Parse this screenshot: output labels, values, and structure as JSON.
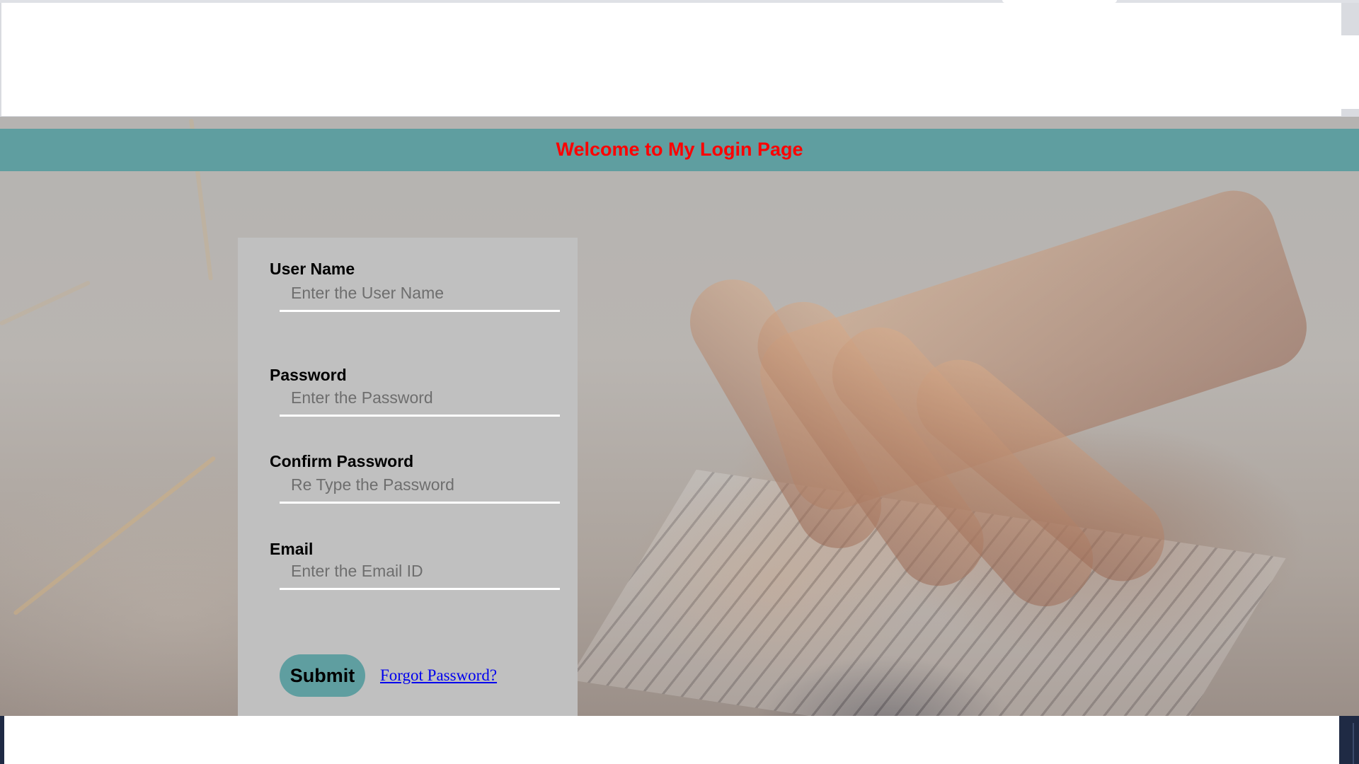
{
  "banner": {
    "title": "Welcome to My Login Page"
  },
  "form": {
    "username": {
      "label": "User Name",
      "placeholder": "Enter the User Name",
      "value": ""
    },
    "password": {
      "label": "Password",
      "placeholder": "Enter the Password",
      "value": ""
    },
    "confirm_password": {
      "label": "Confirm Password",
      "placeholder": "Re Type the Password",
      "value": ""
    },
    "email": {
      "label": "Email",
      "placeholder": "Enter the Email ID",
      "value": ""
    },
    "submit_label": "Submit",
    "forgot_label": "Forgot Password?"
  },
  "colors": {
    "banner_bg": "#5f9ea0",
    "title_text": "#ff0000",
    "card_bg": "#c0c0c0",
    "button_bg": "#5f9ea0",
    "link": "#0000ee"
  }
}
